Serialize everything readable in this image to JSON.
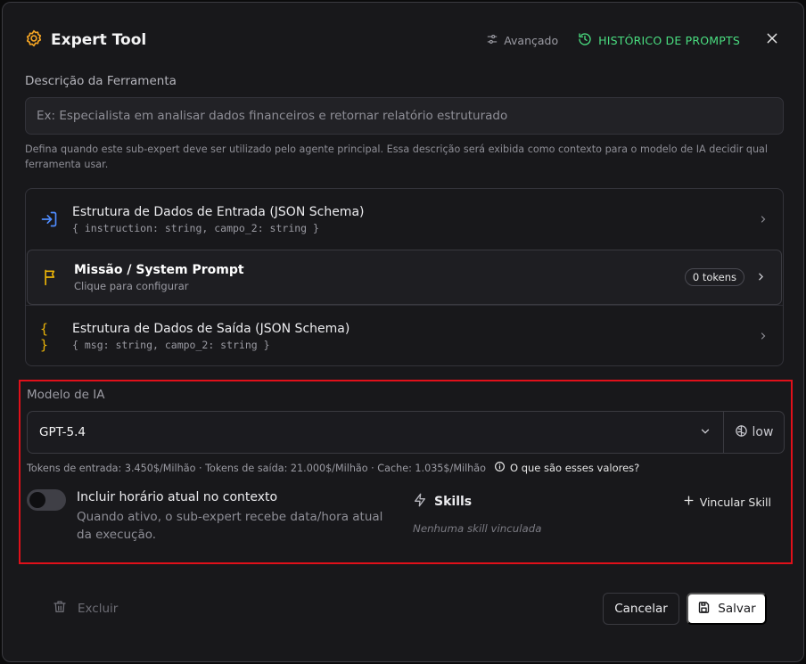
{
  "header": {
    "title": "Expert Tool",
    "advanced_label": "Avançado",
    "history_label": "HISTÓRICO DE PROMPTS"
  },
  "description": {
    "label": "Descrição da Ferramenta",
    "placeholder": "Ex: Especialista em analisar dados financeiros e retornar relatório estruturado",
    "value": "",
    "help": "Defina quando este sub-expert deve ser utilizado pelo agente principal. Essa descrição será exibida como contexto para o modelo de IA decidir qual ferramenta usar."
  },
  "sections": {
    "input_schema": {
      "title": "Estrutura de Dados de Entrada (JSON Schema)",
      "subtitle": "{ instruction: string, campo_2: string }"
    },
    "system_prompt": {
      "title": "Missão / System Prompt",
      "subtitle": "Clique para configurar",
      "tokens": "0 tokens"
    },
    "output_schema": {
      "title": "Estrutura de Dados de Saída (JSON Schema)",
      "subtitle": "{ msg: string, campo_2: string }",
      "icon_text": "{ }"
    }
  },
  "model": {
    "label": "Modelo de IA",
    "selected": "GPT-5.4",
    "effort": "low",
    "pricing": "Tokens de entrada: 3.450$/Milhão · Tokens de saída: 21.000$/Milhão · Cache: 1.035$/Milhão",
    "pricing_help": "O que são esses valores?"
  },
  "context_time": {
    "title": "Incluir horário atual no contexto",
    "description": "Quando ativo, o sub-expert recebe data/hora atual da execução.",
    "enabled": false
  },
  "skills": {
    "title": "Skills",
    "link_label": "Vincular Skill",
    "empty": "Nenhuma skill vinculada"
  },
  "footer": {
    "delete_label": "Excluir",
    "cancel_label": "Cancelar",
    "save_label": "Salvar"
  },
  "colors": {
    "accent_orange": "#f5a524",
    "accent_green": "#4ade80",
    "highlight_red": "#e0101a",
    "input_icon_blue": "#4f8cff",
    "flag_yellow": "#eab308"
  },
  "icons": {
    "title": "gear-cog-icon",
    "advanced": "sliders-icon",
    "history": "history-icon",
    "close": "close-icon",
    "input_schema": "login-arrow-icon",
    "system_prompt": "flag-icon",
    "output_schema": "braces-icon",
    "effort": "brain-icon",
    "pricing_help": "info-icon",
    "skills": "lightning-icon",
    "link_skill": "plus-icon",
    "delete": "trash-icon",
    "save": "save-floppy-icon"
  }
}
